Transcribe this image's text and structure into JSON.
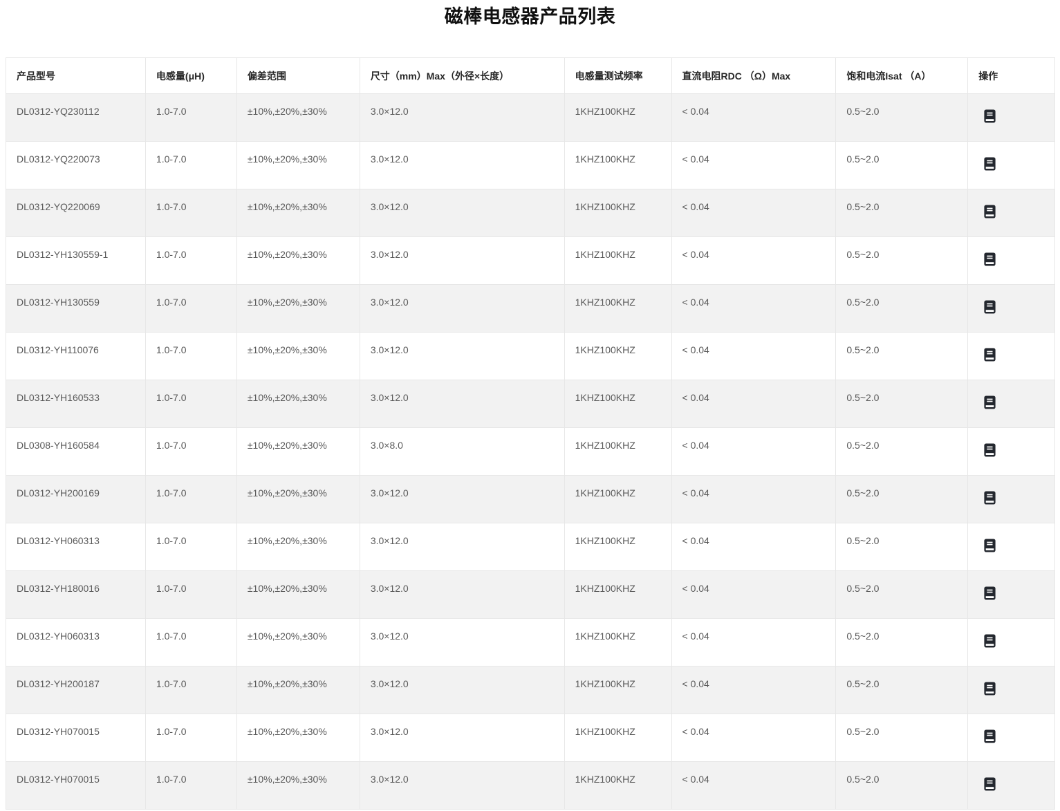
{
  "page": {
    "title": "磁棒电感器产品列表"
  },
  "table": {
    "columns": [
      {
        "key": "model",
        "label": "产品型号"
      },
      {
        "key": "inductance",
        "label": "电感量(μH)"
      },
      {
        "key": "tolerance",
        "label": "偏差范围"
      },
      {
        "key": "size",
        "label": "尺寸（mm）Max（外径×长度）"
      },
      {
        "key": "test_freq",
        "label": "电感量测试频率"
      },
      {
        "key": "rdc_max",
        "label": "直流电阻RDC （Ω）Max"
      },
      {
        "key": "isat",
        "label": "饱和电流Isat （A）"
      },
      {
        "key": "action",
        "label": "操作"
      }
    ],
    "action_icon": "notebook-icon",
    "rows": [
      {
        "model": "DL0312-YQ230112",
        "inductance": "1.0-7.0",
        "tolerance": "±10%,±20%,±30%",
        "size": "3.0×12.0",
        "test_freq": "1KHZ100KHZ",
        "rdc_max": "< 0.04",
        "isat": "0.5~2.0"
      },
      {
        "model": "DL0312-YQ220073",
        "inductance": "1.0-7.0",
        "tolerance": "±10%,±20%,±30%",
        "size": "3.0×12.0",
        "test_freq": "1KHZ100KHZ",
        "rdc_max": "< 0.04",
        "isat": "0.5~2.0"
      },
      {
        "model": "DL0312-YQ220069",
        "inductance": "1.0-7.0",
        "tolerance": "±10%,±20%,±30%",
        "size": "3.0×12.0",
        "test_freq": "1KHZ100KHZ",
        "rdc_max": "< 0.04",
        "isat": "0.5~2.0"
      },
      {
        "model": "DL0312-YH130559-1",
        "inductance": "1.0-7.0",
        "tolerance": "±10%,±20%,±30%",
        "size": "3.0×12.0",
        "test_freq": "1KHZ100KHZ",
        "rdc_max": "< 0.04",
        "isat": "0.5~2.0"
      },
      {
        "model": "DL0312-YH130559",
        "inductance": "1.0-7.0",
        "tolerance": "±10%,±20%,±30%",
        "size": "3.0×12.0",
        "test_freq": "1KHZ100KHZ",
        "rdc_max": "< 0.04",
        "isat": "0.5~2.0"
      },
      {
        "model": "DL0312-YH110076",
        "inductance": "1.0-7.0",
        "tolerance": "±10%,±20%,±30%",
        "size": "3.0×12.0",
        "test_freq": "1KHZ100KHZ",
        "rdc_max": "< 0.04",
        "isat": "0.5~2.0"
      },
      {
        "model": "DL0312-YH160533",
        "inductance": "1.0-7.0",
        "tolerance": "±10%,±20%,±30%",
        "size": "3.0×12.0",
        "test_freq": "1KHZ100KHZ",
        "rdc_max": "< 0.04",
        "isat": "0.5~2.0"
      },
      {
        "model": "DL0308-YH160584",
        "inductance": "1.0-7.0",
        "tolerance": "±10%,±20%,±30%",
        "size": "3.0×8.0",
        "test_freq": "1KHZ100KHZ",
        "rdc_max": "< 0.04",
        "isat": "0.5~2.0"
      },
      {
        "model": "DL0312-YH200169",
        "inductance": "1.0-7.0",
        "tolerance": "±10%,±20%,±30%",
        "size": "3.0×12.0",
        "test_freq": "1KHZ100KHZ",
        "rdc_max": "< 0.04",
        "isat": "0.5~2.0"
      },
      {
        "model": "DL0312-YH060313",
        "inductance": "1.0-7.0",
        "tolerance": "±10%,±20%,±30%",
        "size": "3.0×12.0",
        "test_freq": "1KHZ100KHZ",
        "rdc_max": "< 0.04",
        "isat": "0.5~2.0"
      },
      {
        "model": "DL0312-YH180016",
        "inductance": "1.0-7.0",
        "tolerance": "±10%,±20%,±30%",
        "size": "3.0×12.0",
        "test_freq": "1KHZ100KHZ",
        "rdc_max": "< 0.04",
        "isat": "0.5~2.0"
      },
      {
        "model": "DL0312-YH060313",
        "inductance": "1.0-7.0",
        "tolerance": "±10%,±20%,±30%",
        "size": "3.0×12.0",
        "test_freq": "1KHZ100KHZ",
        "rdc_max": "< 0.04",
        "isat": "0.5~2.0"
      },
      {
        "model": "DL0312-YH200187",
        "inductance": "1.0-7.0",
        "tolerance": "±10%,±20%,±30%",
        "size": "3.0×12.0",
        "test_freq": "1KHZ100KHZ",
        "rdc_max": "< 0.04",
        "isat": "0.5~2.0"
      },
      {
        "model": "DL0312-YH070015",
        "inductance": "1.0-7.0",
        "tolerance": "±10%,±20%,±30%",
        "size": "3.0×12.0",
        "test_freq": "1KHZ100KHZ",
        "rdc_max": "< 0.04",
        "isat": "0.5~2.0"
      },
      {
        "model": "DL0312-YH070015",
        "inductance": "1.0-7.0",
        "tolerance": "±10%,±20%,±30%",
        "size": "3.0×12.0",
        "test_freq": "1KHZ100KHZ",
        "rdc_max": "< 0.04",
        "isat": "0.5~2.0"
      }
    ]
  },
  "colors": {
    "stripe": "#f2f2f2",
    "border": "#e7e7e7",
    "icon": "#23272e",
    "body-text": "#595959",
    "header-text": "#262626",
    "title": "#111111",
    "bg": "#ffffff"
  }
}
